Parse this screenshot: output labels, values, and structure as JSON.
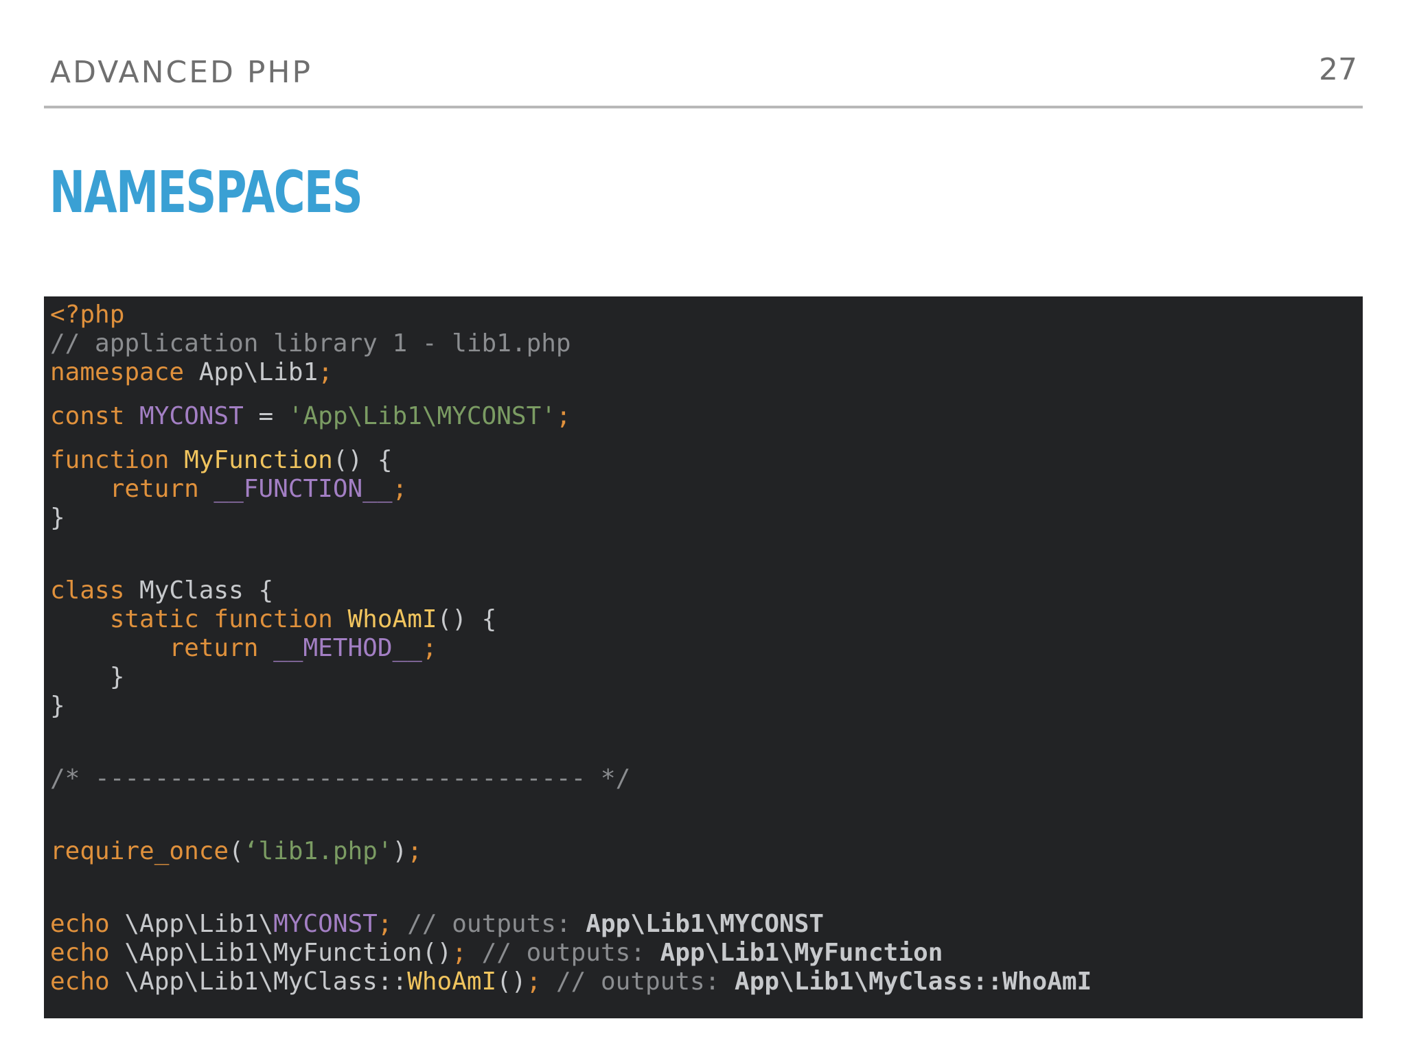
{
  "header": {
    "label": "ADVANCED PHP",
    "page_number": "27"
  },
  "title": "NAMESPACES",
  "colors": {
    "title": "#3aa0d4",
    "header_text": "#6f6f6f",
    "rule": "#b8b8b8",
    "code_background": "#222325",
    "keyword": "#e0913c",
    "comment": "#8b8d90",
    "constant": "#a37fc4",
    "string": "#7b9c63",
    "function_name": "#f0c45e",
    "plain": "#c7c9cc"
  },
  "code": {
    "open_tag": "<?php",
    "comment_lib": "// application library 1 - lib1.php",
    "kw_namespace": "namespace",
    "namespace_name": " App\\Lib1",
    "semi": ";",
    "kw_const": "const",
    "const_name": " MYCONST",
    "assign": " = ",
    "const_value": "'App\\Lib1\\MYCONST'",
    "kw_function": "function",
    "func_name": " MyFunction",
    "func_sig": "() {",
    "indent1": "    ",
    "kw_return": "return",
    "magic_function": " __FUNCTION__",
    "close_brace": "}",
    "kw_class": "class",
    "class_decl": " MyClass {",
    "kw_static": "static",
    "kw_function2": " function",
    "method_name": " WhoAmI",
    "method_sig": "() {",
    "indent2": "        ",
    "magic_method": " __METHOD__",
    "indent_close": "    }",
    "separator": "/* --------------------------------- */",
    "kw_require": "require_once",
    "paren_open": "(",
    "require_arg": "‘lib1.php'",
    "paren_close": ")",
    "kw_echo": "echo",
    "echo1_path": " \\App\\Lib1\\",
    "echo1_const": "MYCONST",
    "echo1_comment": " // outputs: ",
    "echo1_output": "App\\Lib1\\MYCONST",
    "echo2_call": " \\App\\Lib1\\MyFunction()",
    "echo2_comment": " // outputs: ",
    "echo2_output": "App\\Lib1\\MyFunction",
    "echo3_path": " \\App\\Lib1\\MyClass::",
    "echo3_method": "WhoAmI",
    "echo3_parens": "()",
    "echo3_comment": " // outputs: ",
    "echo3_output": "App\\Lib1\\MyClass::WhoAmI"
  }
}
